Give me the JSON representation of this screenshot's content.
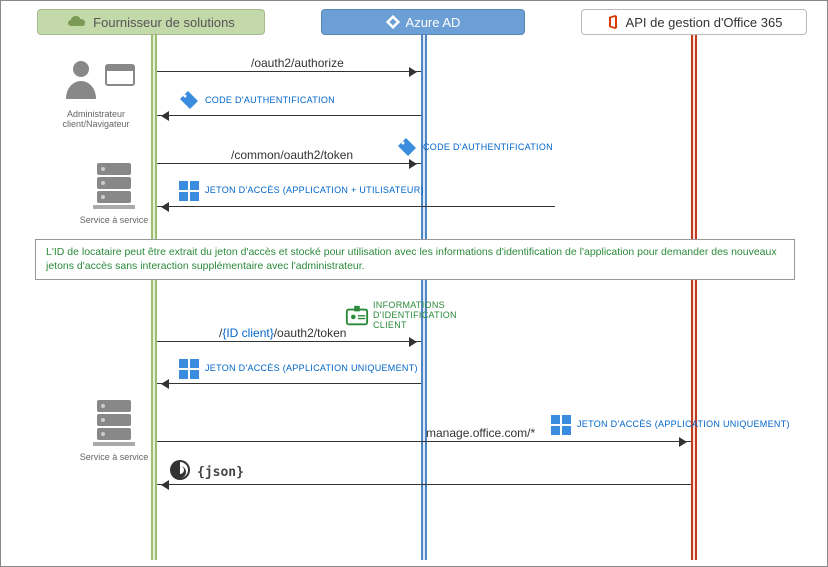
{
  "headers": {
    "solution": "Fournisseur de solutions",
    "ad": "Azure AD",
    "api": "API de gestion d'Office 365"
  },
  "actors": {
    "admin": "Administrateur client/Navigateur",
    "svc1": "Service à service",
    "svc2": "Service à service"
  },
  "arrows": {
    "a1": "/oauth2/authorize",
    "a3": "/common/oauth2/token",
    "a5_pre": "/",
    "a5_id": "{ID client}",
    "a5_post": "/oauth2/token",
    "a7": "manage.office.com/*",
    "a8": "{json}"
  },
  "badges": {
    "auth_code": "CODE D'AUTHENTIFICATION",
    "token_app_user": "JETON D'ACCÈS (APPLICATION + UTILISATEUR)",
    "client_creds": "INFORMATIONS D'IDENTIFICATION CLIENT",
    "token_app_only": "JETON D'ACCÈS (APPLICATION UNIQUEMENT)"
  },
  "note": "L'ID de locataire peut être extrait du jeton d'accès et stocké pour utilisation avec les informations d'identification de l'application pour demander des nouveaux jetons d'accès sans interaction supplémentaire avec l'administrateur."
}
